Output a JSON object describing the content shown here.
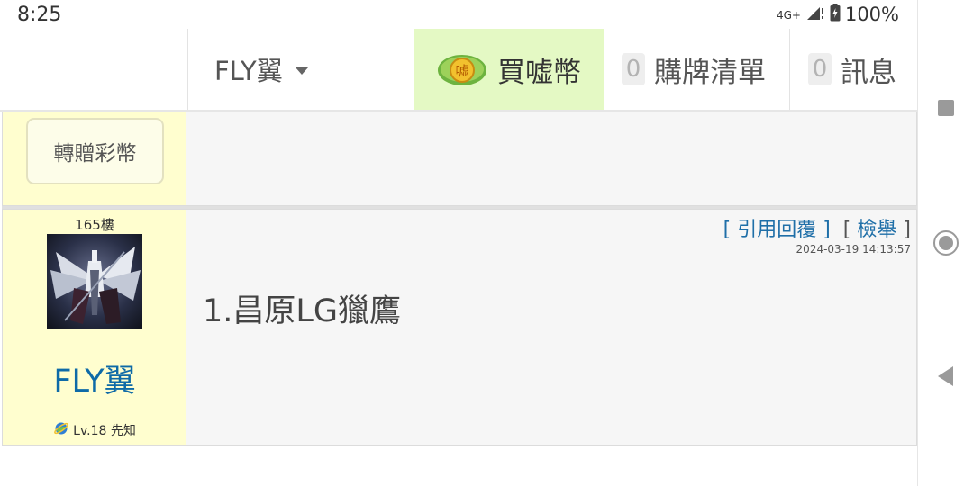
{
  "status_bar": {
    "time": "8:25",
    "network": "4G+",
    "battery": "100%"
  },
  "header": {
    "user_name": "FLY翼",
    "buy_coins_label": "買嘘幣",
    "buy_coins_icon": "嘘",
    "purchase_list_count": "0",
    "purchase_list_label": "購牌清單",
    "messages_count": "0",
    "messages_label": "訊息"
  },
  "gift_block": {
    "gift_button_label": "轉贈彩幣"
  },
  "post": {
    "floor": "165樓",
    "poster_name": "FLY翼",
    "level": "Lv.18 先知",
    "quote_reply_label": "引用回覆",
    "report_label": "檢舉",
    "bracket_open": "[",
    "bracket_close": "]",
    "timestamp": "2024-03-19 14:13:57",
    "content": "1.昌原LG獵鷹"
  },
  "colors": {
    "buy_bg": "#e4f9c4",
    "left_col_bg": "#fffecf",
    "link": "#1f6fa8",
    "poster_name": "#0e6aa7"
  },
  "icons": [
    "signal-icon",
    "battery-icon",
    "coin-icon",
    "planet-icon",
    "square-nav-icon",
    "circle-nav-icon",
    "back-nav-icon"
  ]
}
